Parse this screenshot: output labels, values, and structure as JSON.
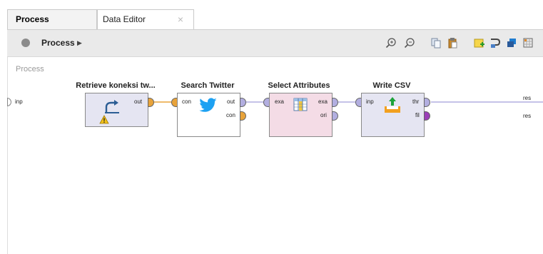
{
  "tabs": [
    {
      "label": "Process",
      "active": true
    },
    {
      "label": "Data Editor",
      "active": false,
      "close": "×"
    }
  ],
  "toolbar": {
    "process_label": "Process",
    "arrow": "▶",
    "icons": [
      "zoom-in-icon",
      "zoom-out-icon",
      "copy-icon",
      "paste-icon",
      "add-note-icon",
      "auto-wire-icon",
      "layers-icon",
      "grid-icon"
    ]
  },
  "canvas": {
    "title": "Process",
    "left_port": "inp",
    "right_ports": [
      "res",
      "res"
    ]
  },
  "operators": [
    {
      "title": "Retrieve koneksi tw...",
      "ports_out": [
        "out"
      ],
      "warning": true
    },
    {
      "title": "Search Twitter",
      "ports_in": [
        "con"
      ],
      "ports_out": [
        "out",
        "con"
      ]
    },
    {
      "title": "Select Attributes",
      "ports_in": [
        "exa"
      ],
      "ports_out": [
        "exa",
        "ori"
      ]
    },
    {
      "title": "Write CSV",
      "ports_in": [
        "inp"
      ],
      "ports_out": [
        "thr",
        "fil"
      ]
    }
  ],
  "colors": {
    "orange_port": "#e8a33a",
    "lilac_port": "#b2aee0",
    "purple_port": "#9b3fb8",
    "retrieve_fill": "#e5e5f2",
    "twitter_fill": "#ffffff",
    "select_fill": "#f4dce6",
    "write_fill": "#e5e5f2"
  }
}
